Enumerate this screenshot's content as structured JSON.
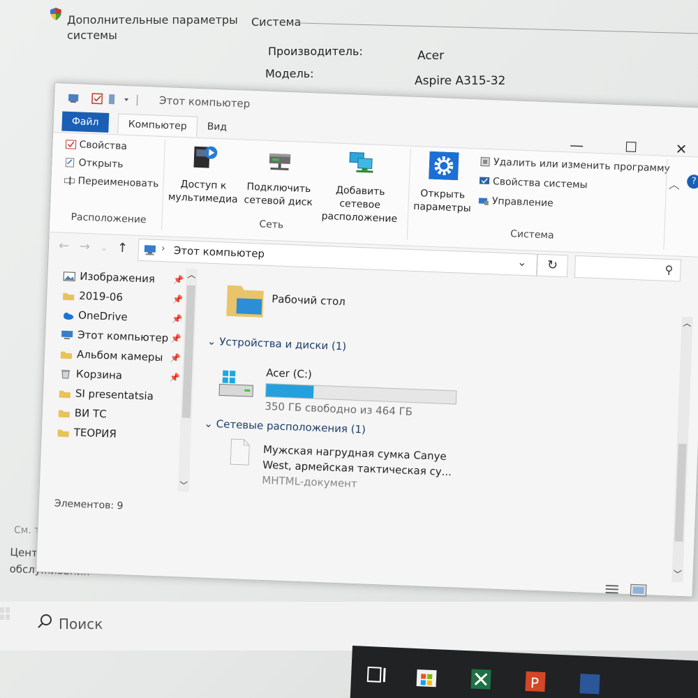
{
  "system_window": {
    "title_line1": "Дополнительные параметры",
    "title_line2": "системы",
    "section": "Система",
    "manufacturer_label": "Производитель:",
    "manufacturer_value": "Acer",
    "model_label": "Модель:",
    "model_value": "Aspire A315-32",
    "see_also": "См. также",
    "link_line1": "Центр безопасности и",
    "link_line2": "обслуживания"
  },
  "explorer": {
    "window_title": "Этот компьютер",
    "tabs": [
      "Файл",
      "Компьютер",
      "Вид"
    ],
    "location_group": {
      "label": "Расположение",
      "properties": "Свойства",
      "open": "Открыть",
      "rename": "Переименовать"
    },
    "network_group": {
      "label": "Сеть",
      "media_line1": "Доступ к",
      "media_line2": "мультимедиа",
      "map_drive_line1": "Подключить",
      "map_drive_line2": "сетевой диск",
      "add_location_line1": "Добавить сетевое",
      "add_location_line2": "расположение"
    },
    "system_group": {
      "label": "Система",
      "open_settings_line1": "Открыть",
      "open_settings_line2": "параметры",
      "uninstall": "Удалить или изменить программу",
      "system_properties": "Свойства системы",
      "manage": "Управление"
    },
    "address": "Этот компьютер",
    "nav_items": [
      {
        "label": "Изображения",
        "pinned": true
      },
      {
        "label": "2019-06",
        "pinned": true
      },
      {
        "label": "OneDrive",
        "pinned": true
      },
      {
        "label": "Этот компьютер",
        "pinned": true
      },
      {
        "label": "Альбом камеры",
        "pinned": true
      },
      {
        "label": "Корзина",
        "pinned": true
      },
      {
        "label": "SI presentatsia",
        "pinned": false
      },
      {
        "label": "ВИ ТС",
        "pinned": false
      },
      {
        "label": "ТЕОРИЯ",
        "pinned": false
      }
    ],
    "status": "Элементов: 9",
    "desktop_label": "Рабочий стол",
    "devices_header": "Устройства и диски (1)",
    "drive_name": "Acer (C:)",
    "drive_used_fraction": 0.25,
    "drive_free_text": "350 ГБ свободно из 464 ГБ",
    "network_header": "Сетевые расположения (1)",
    "network_item_line1": "Мужская нагрудная сумка Canye",
    "network_item_line2": "West, армейская тактическая су...",
    "network_item_type": "MHTML-документ"
  },
  "taskbar": {
    "search_placeholder": "Поиск"
  },
  "colors": {
    "accent": "#1a5fb4",
    "drive_bar": "#26a0da"
  }
}
